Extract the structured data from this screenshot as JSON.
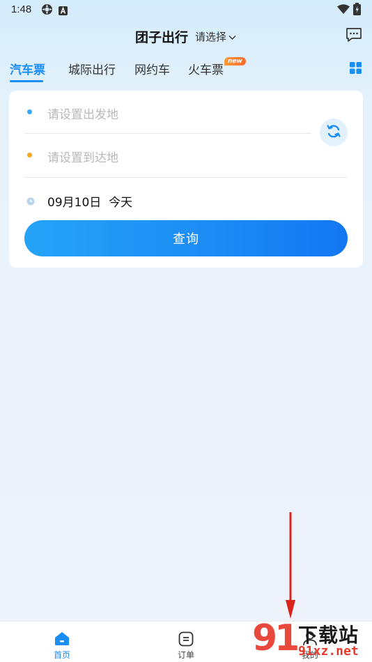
{
  "status_bar": {
    "time": "1:48"
  },
  "header": {
    "title": "团子出行",
    "city_select": "请选择"
  },
  "tabs": [
    {
      "label": "汽车票",
      "active": true
    },
    {
      "label": "城际出行",
      "active": false
    },
    {
      "label": "网约车",
      "active": false
    },
    {
      "label": "火车票",
      "active": false,
      "badge": "new"
    }
  ],
  "search_form": {
    "departure_placeholder": "请设置出发地",
    "arrival_placeholder": "请设置到达地",
    "date": "09月10日",
    "date_note": "今天",
    "query_label": "查询"
  },
  "bottom_nav": [
    {
      "label": "首页",
      "icon": "home-icon",
      "active": true
    },
    {
      "label": "订单",
      "icon": "order-icon",
      "active": false
    },
    {
      "label": "我的",
      "icon": "profile-icon",
      "active": false
    }
  ],
  "watermark": {
    "brand": "91",
    "title": "下载站",
    "url": "91xz.net"
  },
  "colors": {
    "accent": "#1b8ef5",
    "departure_dot": "#3aa6f5",
    "arrival_dot": "#f5a623",
    "annotation_arrow": "#d9231b"
  }
}
